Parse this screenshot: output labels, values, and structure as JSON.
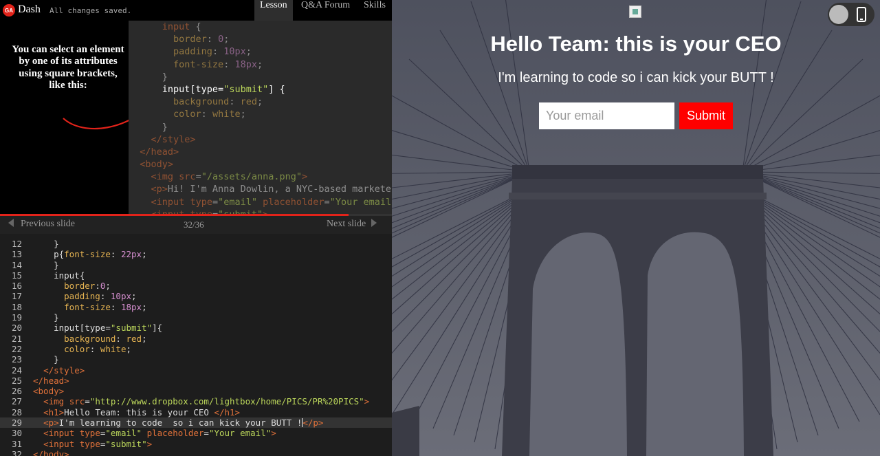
{
  "topbar": {
    "logo_text": "GA",
    "app_name": "Dash",
    "save_status": "All changes saved.",
    "tabs": [
      {
        "label": "Lesson",
        "active": true
      },
      {
        "label": "Q&A Forum",
        "active": false
      },
      {
        "label": "Skills",
        "active": false
      }
    ]
  },
  "lesson": {
    "note": "You can select an element by one of its attributes using square brackets, like this:"
  },
  "slides": {
    "prev_label": "Previous slide",
    "next_label": "Next slide",
    "current": 32,
    "total": 36,
    "counter": "32/36"
  },
  "preview": {
    "title": "Hello Team: this is your CEO",
    "subtitle": "I'm learning to code so i can kick your BUTT !",
    "email_placeholder": "Your email",
    "submit_label": "Submit"
  },
  "colors": {
    "accent": "#e2231a",
    "submit": "#ff0000"
  },
  "icons": [
    "ga-logo-icon",
    "broken-image-icon",
    "toggle-icon",
    "phone-icon",
    "prev-arrow-icon",
    "next-arrow-icon"
  ]
}
